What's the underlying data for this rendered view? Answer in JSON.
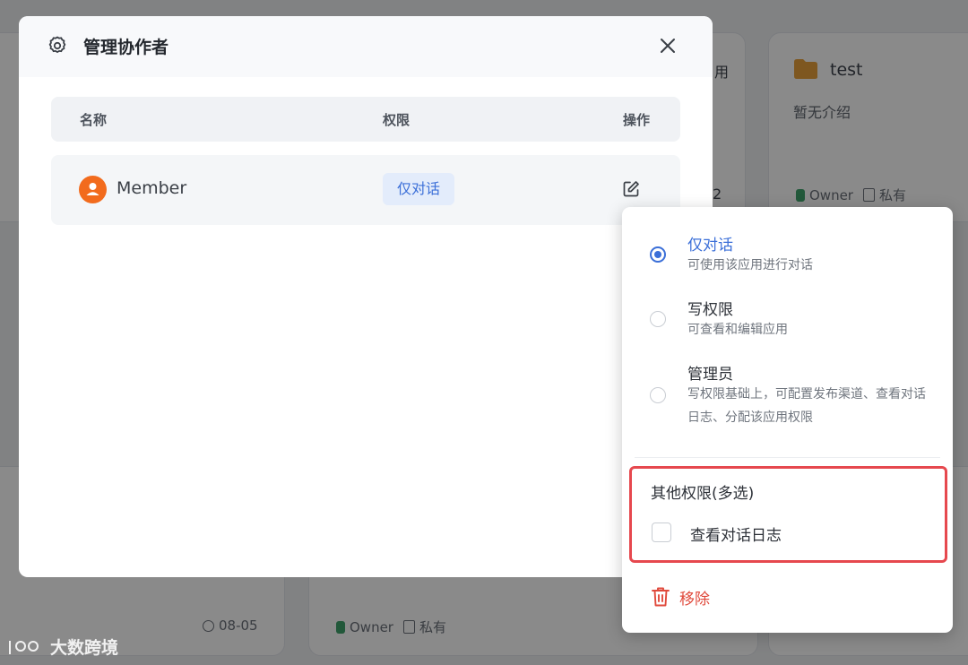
{
  "background": {
    "cards": [
      {
        "title": "test",
        "desc": "暂无介绍",
        "owner": "Owner",
        "visibility": "私有"
      },
      {
        "owner": "Owner",
        "visibility": "私有"
      }
    ],
    "partial_text_1": "用",
    "partial_text_2": "2",
    "date": "08-05"
  },
  "modal": {
    "title": "管理协作者",
    "columns": {
      "name": "名称",
      "permission": "权限",
      "action": "操作"
    },
    "rows": [
      {
        "name": "Member",
        "permission": "仅对话"
      }
    ]
  },
  "popover": {
    "options": [
      {
        "title": "仅对话",
        "desc": "可使用该应用进行对话",
        "selected": true
      },
      {
        "title": "写权限",
        "desc": "可查看和编辑应用",
        "selected": false
      },
      {
        "title": "管理员",
        "desc": "写权限基础上，可配置发布渠道、查看对话日志、分配该应用权限",
        "selected": false
      }
    ],
    "other_title": "其他权限(多选)",
    "other_items": [
      {
        "label": "查看对话日志",
        "checked": false
      }
    ],
    "remove_label": "移除"
  },
  "watermark": "大数跨境",
  "colors": {
    "accent": "#3b6fd8",
    "danger": "#e04a3c",
    "avatar": "#f26b1d",
    "highlight": "#e6484e"
  }
}
